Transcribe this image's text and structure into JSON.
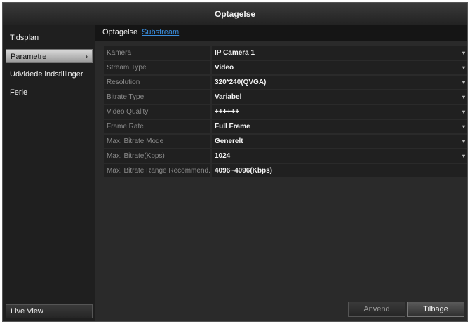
{
  "window": {
    "title": "Optagelse"
  },
  "sidebar": {
    "items": [
      {
        "label": "Tidsplan"
      },
      {
        "label": "Parametre",
        "chevron": "›"
      },
      {
        "label": "Udvidede indstillinger"
      },
      {
        "label": "Ferie"
      }
    ],
    "live_view": "Live View"
  },
  "tabs": [
    {
      "label": "Optagelse"
    },
    {
      "label": "Substream"
    }
  ],
  "form": {
    "rows": [
      {
        "label": "Kamera",
        "value": "IP Camera 1"
      },
      {
        "label": "Stream Type",
        "value": "Video"
      },
      {
        "label": "Resolution",
        "value": "320*240(QVGA)"
      },
      {
        "label": "Bitrate Type",
        "value": "Variabel"
      },
      {
        "label": "Video Quality",
        "value": "++++++"
      },
      {
        "label": "Frame Rate",
        "value": "Full Frame"
      },
      {
        "label": "Max. Bitrate Mode",
        "value": "Generelt"
      },
      {
        "label": "Max. Bitrate(Kbps)",
        "value": "1024"
      },
      {
        "label": "Max. Bitrate Range Recommend...",
        "value": "4096~4096(Kbps)"
      }
    ],
    "dropdown_arrow": "▾"
  },
  "buttons": {
    "apply": "Anvend",
    "back": "Tilbage"
  }
}
